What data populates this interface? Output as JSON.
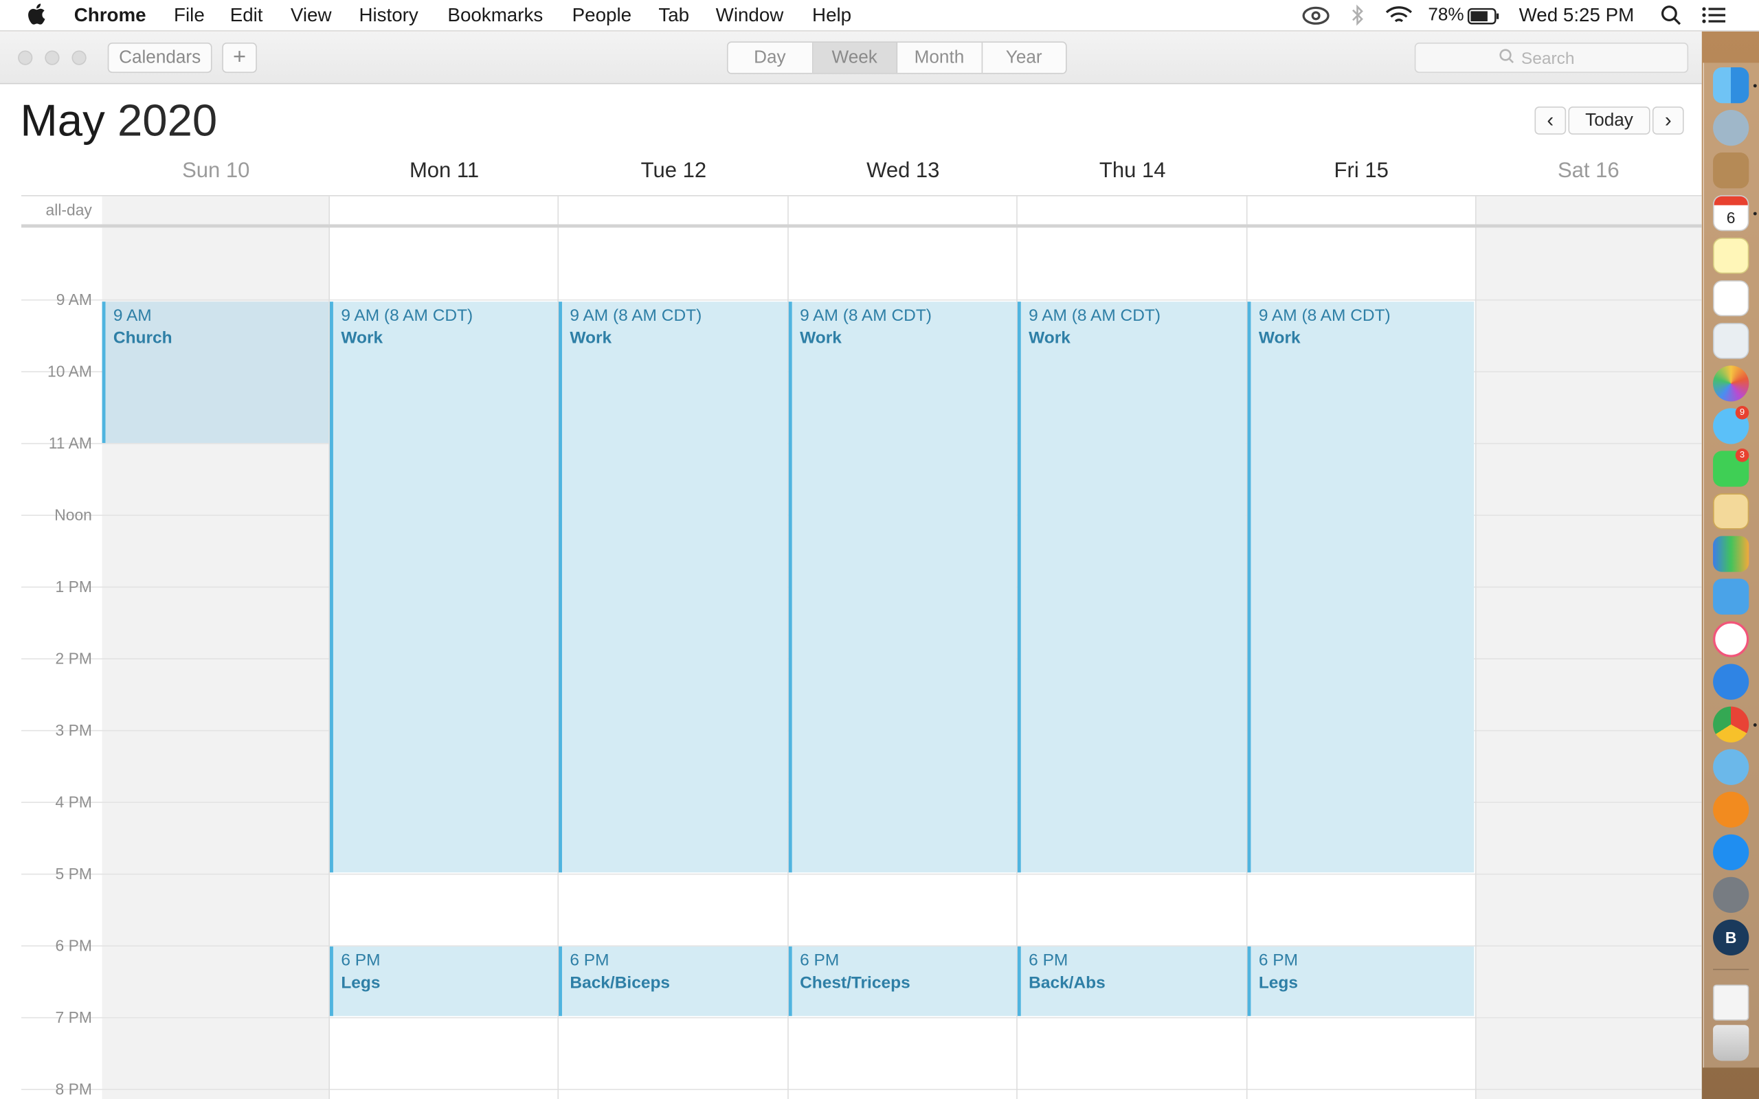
{
  "menubar": {
    "app": "Chrome",
    "items": [
      "File",
      "Edit",
      "View",
      "History",
      "Bookmarks",
      "People",
      "Tab",
      "Window",
      "Help"
    ],
    "battery": "78%",
    "clock": "Wed 5:25 PM"
  },
  "toolbar": {
    "calendars_label": "Calendars",
    "add_label": "+",
    "views": [
      "Day",
      "Week",
      "Month",
      "Year"
    ],
    "active_view": "Week",
    "search_placeholder": "Search"
  },
  "header": {
    "month": "May",
    "year": "2020",
    "prev": "‹",
    "today": "Today",
    "next": "›"
  },
  "days": [
    "Sun 10",
    "Mon 11",
    "Tue 12",
    "Wed 13",
    "Thu 14",
    "Fri 15",
    "Sat 16"
  ],
  "allday_label": "all-day",
  "hours": [
    "9 AM",
    "10 AM",
    "11 AM",
    "Noon",
    "1 PM",
    "2 PM",
    "3 PM",
    "4 PM",
    "5 PM",
    "6 PM",
    "7 PM",
    "8 PM"
  ],
  "events": {
    "sun_church": {
      "time": "9 AM",
      "title": "Church"
    },
    "mon_work": {
      "time": "9 AM (8 AM CDT)",
      "title": "Work"
    },
    "tue_work": {
      "time": "9 AM (8 AM CDT)",
      "title": "Work"
    },
    "wed_work": {
      "time": "9 AM (8 AM CDT)",
      "title": "Work"
    },
    "thu_work": {
      "time": "9 AM (8 AM CDT)",
      "title": "Work"
    },
    "fri_work": {
      "time": "9 AM (8 AM CDT)",
      "title": "Work"
    },
    "mon_gym": {
      "time": "6 PM",
      "title": "Legs"
    },
    "tue_gym": {
      "time": "6 PM",
      "title": "Back/Biceps"
    },
    "wed_gym": {
      "time": "6 PM",
      "title": "Chest/Triceps"
    },
    "thu_gym": {
      "time": "6 PM",
      "title": "Back/Abs"
    },
    "fri_gym": {
      "time": "6 PM",
      "title": "Legs"
    }
  },
  "dock": {
    "calendar_day": "6",
    "messages_badge": "9",
    "facetime_badge": "3",
    "avatar_letter": "B"
  },
  "colors": {
    "event_fill": "#d4ebf4",
    "event_border": "#4fb4df",
    "event_text": "#2e7fa6",
    "weekend_bg": "#f2f2f2"
  }
}
